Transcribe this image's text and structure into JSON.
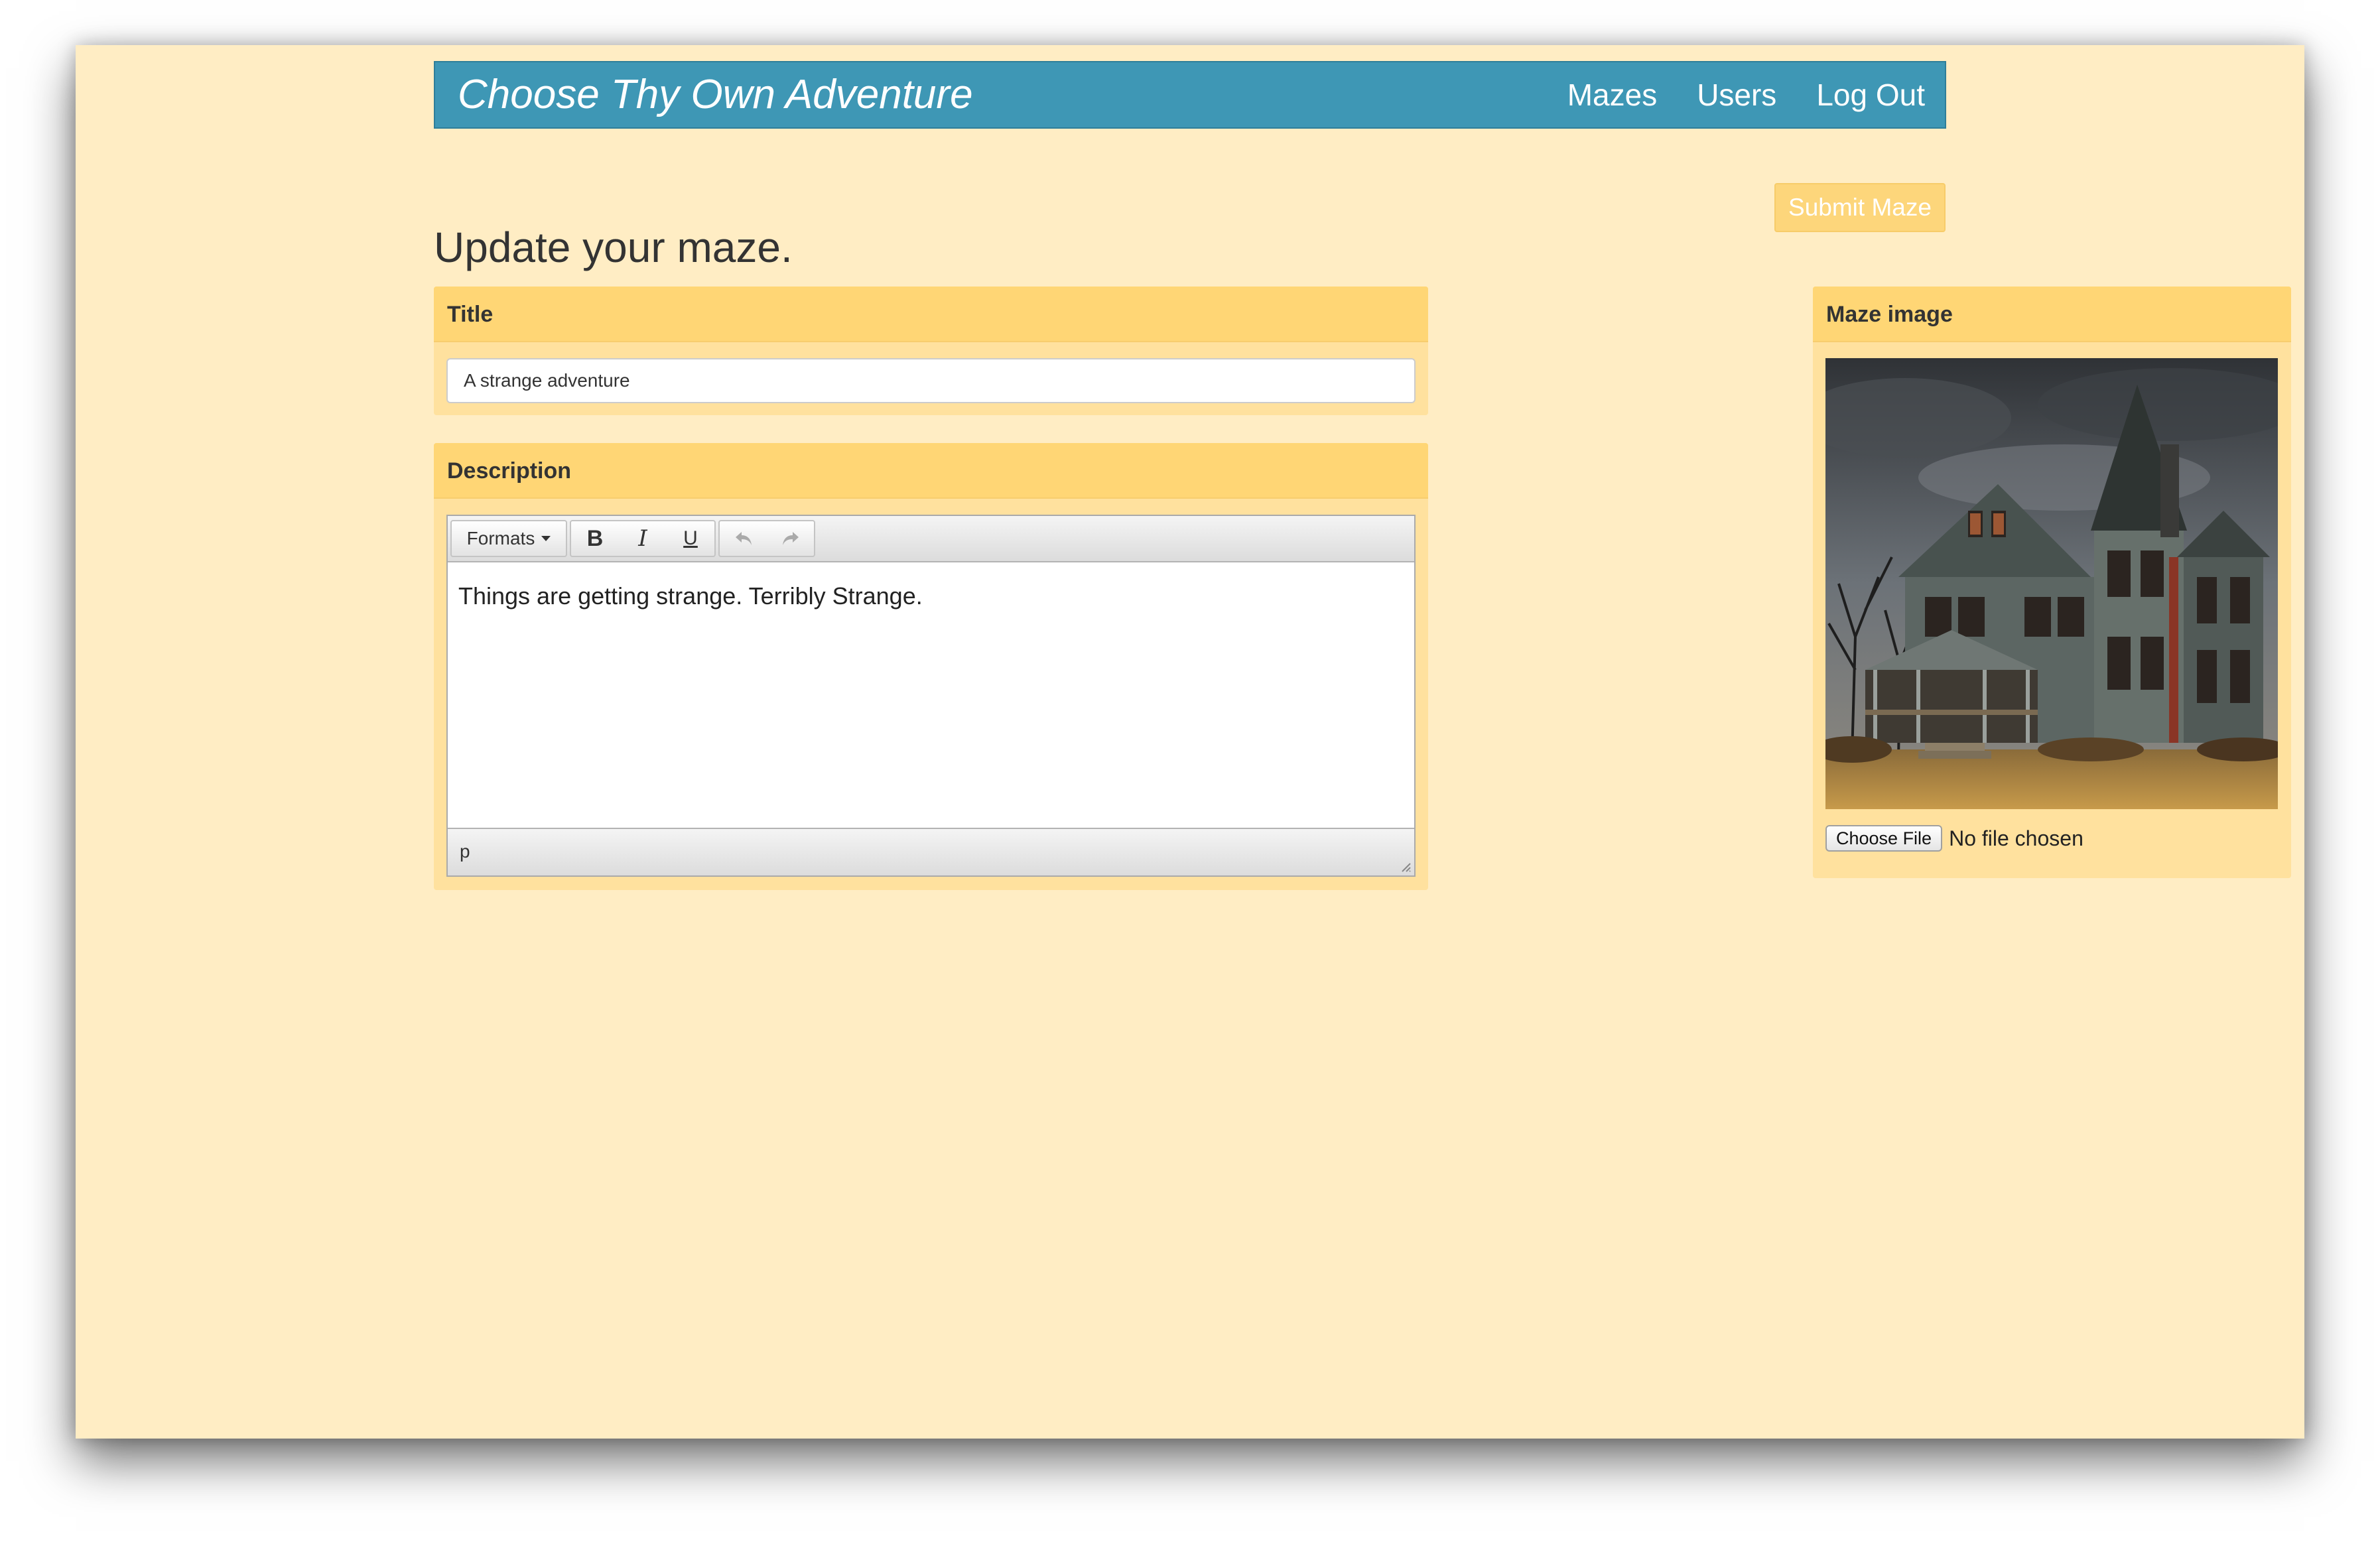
{
  "app": {
    "brand": "Choose Thy Own Adventure"
  },
  "nav": {
    "items": [
      {
        "label": "Mazes"
      },
      {
        "label": "Users"
      },
      {
        "label": "Log Out"
      }
    ]
  },
  "page": {
    "heading": "Update your maze.",
    "submit_label": "Submit Maze"
  },
  "title_panel": {
    "heading": "Title",
    "value": "A strange adventure"
  },
  "description_panel": {
    "heading": "Description",
    "toolbar": {
      "formats_label": "Formats",
      "bold_label": "B",
      "italic_label": "I",
      "underline_label": "U",
      "undo_icon": "undo-icon",
      "redo_icon": "redo-icon"
    },
    "content": "Things are getting strange.  Terribly Strange.",
    "status_path": "p"
  },
  "image_panel": {
    "heading": "Maze image",
    "image_subject": "haunted-house-photo",
    "choose_file_label": "Choose File",
    "file_status": "No file chosen"
  },
  "colors": {
    "page_bg": "#ffedc4",
    "navbar": "#3e97b5",
    "panel_heading": "#ffd675",
    "panel_body": "#ffe19e",
    "submit_button": "#fdd67b"
  }
}
